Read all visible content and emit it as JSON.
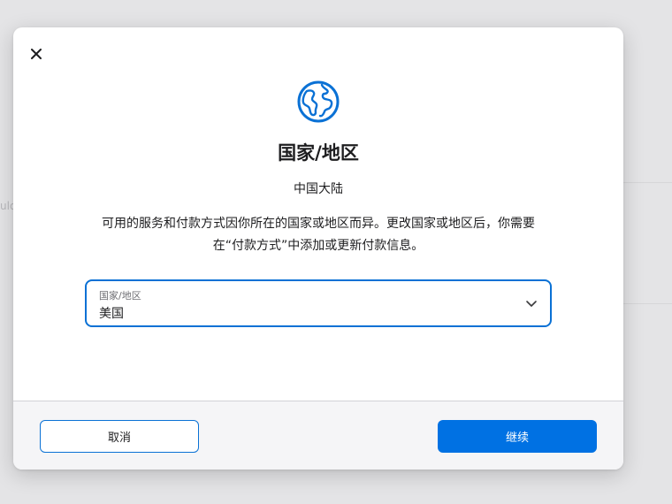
{
  "background": {
    "partial_text": "ulo"
  },
  "dialog": {
    "close_icon": "close-icon",
    "globe_icon": "globe-icon",
    "title": "国家/地区",
    "current_region": "中国大陆",
    "description_line1": "可用的服务和付款方式因你所在的国家或地区而异。更改国家或地区后，你需要",
    "description_line2": "在“付款方式”中添加或更新付款信息。",
    "select": {
      "label": "国家/地区",
      "value": "美国",
      "icon": "chevron-down-icon"
    },
    "footer": {
      "cancel_label": "取消",
      "continue_label": "继续"
    }
  },
  "colors": {
    "accent": "#0071e3",
    "focus_border": "#0a71d5",
    "text": "#1d1d1f",
    "muted_text": "#6e6e73",
    "footer_bg": "#f5f5f7"
  }
}
